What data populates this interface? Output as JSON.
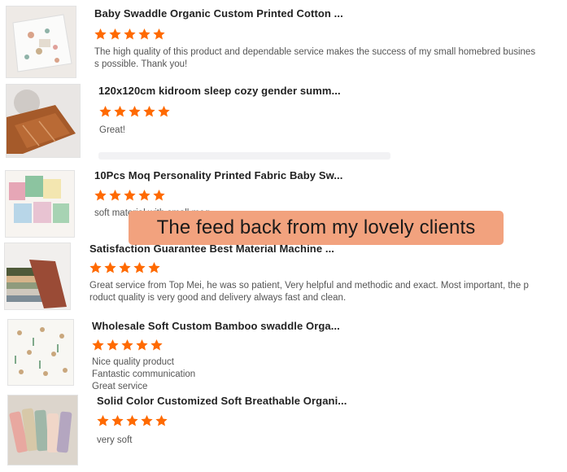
{
  "banner": {
    "text": "The feed back from my lovely clients"
  },
  "colors": {
    "star": "#ff6a00",
    "banner_bg": "#f2a27e"
  },
  "reviews": [
    {
      "title": "Baby Swaddle Organic Custom Printed Cotton ...",
      "rating": 5,
      "comment": "The high quality of this product and dependable service makes the success of my small homebred busines\ns possible. Thank you!"
    },
    {
      "title": "120x120cm kidroom sleep cozy gender summ...",
      "rating": 5,
      "comment": "Great!"
    },
    {
      "title": "10Pcs Moq Personality Printed Fabric Baby Sw...",
      "rating": 5,
      "comment": "soft material with small moq"
    },
    {
      "title": "Satisfaction Guarantee Best Material Machine ...",
      "rating": 5,
      "comment": "Great service from Top Mei, he was so patient,  Very helpful and methodic and exact. Most important, the p\nroduct quality is very good and delivery always fast and clean."
    },
    {
      "title": "Wholesale Soft Custom Bamboo swaddle Orga...",
      "rating": 5,
      "comment": "Nice quality product\nFantastic communication\nGreat service"
    },
    {
      "title": "Solid Color Customized Soft Breathable Organi...",
      "rating": 5,
      "comment": "very soft"
    }
  ]
}
